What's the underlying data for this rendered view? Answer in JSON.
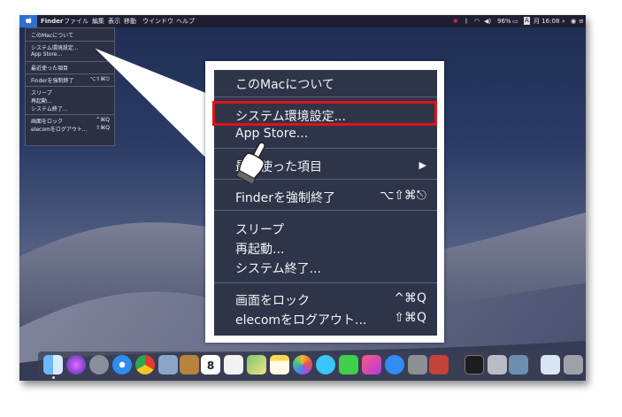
{
  "menubar": {
    "app": "Finder",
    "items": [
      "ファイル",
      "編集",
      "表示",
      "移動",
      "ウインドウ",
      "ヘルプ"
    ],
    "battery": "96%",
    "input_method": "A",
    "clock": "月 16:08"
  },
  "small_menu": {
    "items": [
      {
        "label": "このMacについて",
        "shortcut": ""
      },
      {
        "label": "システム環境設定...",
        "shortcut": ""
      },
      {
        "label": "App Store...",
        "shortcut": ""
      },
      {
        "label": "最近使った項目",
        "shortcut": ""
      },
      {
        "label": "Finderを強制終了",
        "shortcut": "⌥⇧⌘⎋"
      },
      {
        "label": "スリープ",
        "shortcut": ""
      },
      {
        "label": "再起動...",
        "shortcut": ""
      },
      {
        "label": "システム終了...",
        "shortcut": ""
      },
      {
        "label": "画面をロック",
        "shortcut": "^⌘Q"
      },
      {
        "label": "elecomをログアウト...",
        "shortcut": "⇧⌘Q"
      }
    ]
  },
  "zoom_menu": {
    "about": "このMacについて",
    "system_prefs": "システム環境設定...",
    "app_store": "App Store...",
    "recent_items": "最近使った項目",
    "recent_arrow": "▶",
    "force_quit": "Finderを強制終了",
    "force_quit_shortcut": "⌥⇧⌘⎋",
    "sleep": "スリープ",
    "restart": "再起動...",
    "shutdown": "システム終了...",
    "lock_screen": "画面をロック",
    "lock_shortcut": "^⌘Q",
    "logout": "elecomをログアウト...",
    "logout_shortcut": "⇧⌘Q"
  },
  "dock": {
    "calendar_day": "8",
    "icons": [
      "finder-icon",
      "siri-icon",
      "launchpad-icon",
      "safari-icon",
      "chrome-icon",
      "preview-icon",
      "contacts-icon",
      "calendar-icon",
      "reminders-icon",
      "maps-icon",
      "notes-icon",
      "photos-icon",
      "messages-icon",
      "facetime-icon",
      "music-icon",
      "appstore-icon",
      "system-preferences-icon",
      "utility-icon",
      "terminal-icon",
      "keychain-icon",
      "screenshot-icon",
      "downloads-icon",
      "trash-icon"
    ]
  },
  "colors": {
    "highlight_border": "#e0121a",
    "menu_bg": "#2f3548",
    "menubar_selected": "#2f6fd1"
  }
}
